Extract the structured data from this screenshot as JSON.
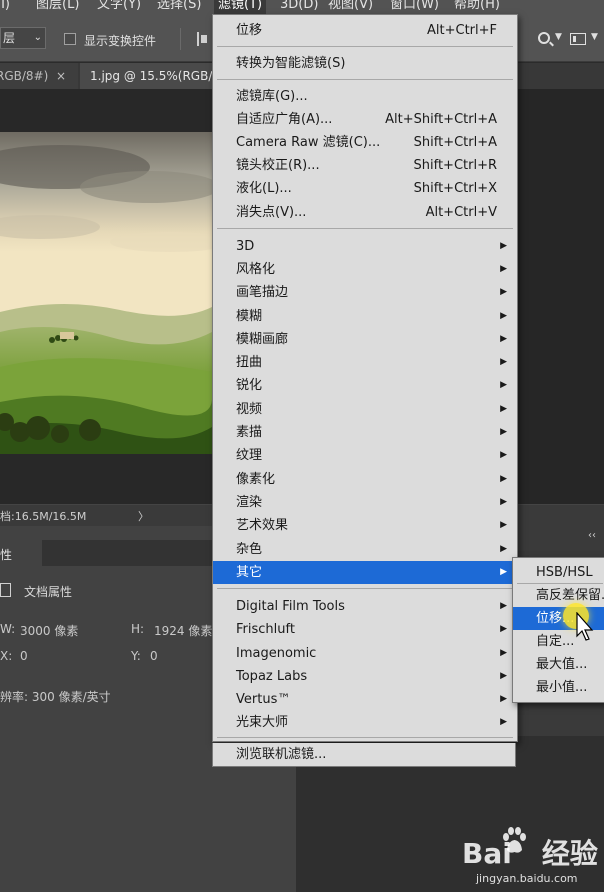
{
  "menubar": {
    "items": [
      {
        "label": "(I)"
      },
      {
        "label": "图层(L)"
      },
      {
        "label": "文字(Y)"
      },
      {
        "label": "选择(S)"
      },
      {
        "label": "滤镜(T)"
      },
      {
        "label": "3D(D)"
      },
      {
        "label": "视图(V)"
      },
      {
        "label": "窗口(W)"
      },
      {
        "label": "帮助(H)"
      }
    ]
  },
  "options_bar": {
    "layer_select": "层",
    "show_transform_label": "显示变换控件"
  },
  "tabs": [
    {
      "label": "RGB/8#)",
      "close": "×"
    },
    {
      "label": "1.jpg @ 15.5%(RGB/"
    }
  ],
  "status": {
    "doc_size": "档:16.5M/16.5M",
    "arrow": "〉"
  },
  "properties_panel": {
    "tab_label": "性",
    "title": "文档属性",
    "width_label": "W:",
    "width_value": "3000 像素",
    "height_label": "H:",
    "height_value": "1924 像素",
    "x_label": "X:",
    "x_value": "0",
    "y_label": "Y:",
    "y_value": "0",
    "resolution": "辨率: 300 像素/英寸",
    "collapse": "‹‹"
  },
  "filter_menu": {
    "items": [
      {
        "label": "位移",
        "shortcut": "Alt+Ctrl+F"
      },
      {
        "label": "转换为智能滤镜(S)",
        "shortcut": ""
      },
      {
        "label": "滤镜库(G)...",
        "shortcut": ""
      },
      {
        "label": "自适应广角(A)...",
        "shortcut": "Alt+Shift+Ctrl+A"
      },
      {
        "label": "Camera Raw 滤镜(C)...",
        "shortcut": "Shift+Ctrl+A"
      },
      {
        "label": "镜头校正(R)...",
        "shortcut": "Shift+Ctrl+R"
      },
      {
        "label": "液化(L)...",
        "shortcut": "Shift+Ctrl+X"
      },
      {
        "label": "消失点(V)...",
        "shortcut": "Alt+Ctrl+V"
      },
      {
        "label": "3D",
        "submenu": true
      },
      {
        "label": "风格化",
        "submenu": true
      },
      {
        "label": "画笔描边",
        "submenu": true
      },
      {
        "label": "模糊",
        "submenu": true
      },
      {
        "label": "模糊画廊",
        "submenu": true
      },
      {
        "label": "扭曲",
        "submenu": true
      },
      {
        "label": "锐化",
        "submenu": true
      },
      {
        "label": "视频",
        "submenu": true
      },
      {
        "label": "素描",
        "submenu": true
      },
      {
        "label": "纹理",
        "submenu": true
      },
      {
        "label": "像素化",
        "submenu": true
      },
      {
        "label": "渲染",
        "submenu": true
      },
      {
        "label": "艺术效果",
        "submenu": true
      },
      {
        "label": "杂色",
        "submenu": true
      },
      {
        "label": "其它",
        "submenu": true,
        "highlighted": true
      },
      {
        "label": "Digital Film Tools",
        "submenu": true
      },
      {
        "label": "Frischluft",
        "submenu": true
      },
      {
        "label": "Imagenomic",
        "submenu": true
      },
      {
        "label": "Topaz Labs",
        "submenu": true
      },
      {
        "label": "Vertus™",
        "submenu": true
      },
      {
        "label": "光束大师",
        "submenu": true
      },
      {
        "label": "浏览联机滤镜...",
        "shortcut": ""
      }
    ],
    "arrow_glyph": "▶"
  },
  "other_submenu": {
    "items": [
      {
        "label": "HSB/HSL"
      },
      {
        "label": "高反差保留..."
      },
      {
        "label": "位移...",
        "highlighted": true
      },
      {
        "label": "自定..."
      },
      {
        "label": "最大值..."
      },
      {
        "label": "最小值..."
      }
    ]
  },
  "watermark": {
    "logo_left": "Bai",
    "logo_right": "经验",
    "site": "jingyan.baidu.com"
  },
  "colors": {
    "menu_bg": "#dcdcdc",
    "highlight": "#1d6ad6",
    "cursor_glow": "#ffe628"
  }
}
